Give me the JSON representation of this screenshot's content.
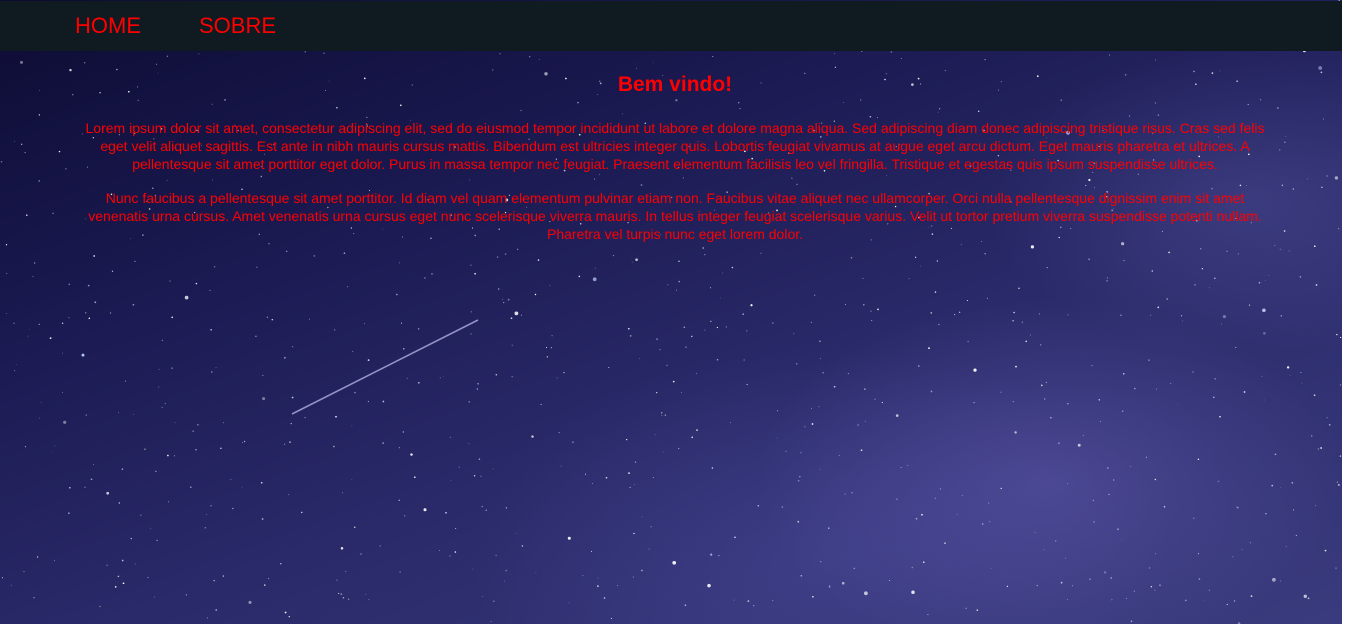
{
  "nav": {
    "home": "HOME",
    "sobre": "SOBRE"
  },
  "main": {
    "title": "Bem vindo!",
    "paragraphs": [
      "Lorem ipsum dolor sit amet, consectetur adipiscing elit, sed do eiusmod tempor incididunt ut labore et dolore magna aliqua. Sed adipiscing diam donec adipiscing tristique risus. Cras sed felis eget velit aliquet sagittis. Est ante in nibh mauris cursus mattis. Bibendum est ultricies integer quis. Lobortis feugiat vivamus at augue eget arcu dictum. Eget mauris pharetra et ultrices. A pellentesque sit amet porttitor eget dolor. Purus in massa tempor nec feugiat. Praesent elementum facilisis leo vel fringilla. Tristique et egestas quis ipsum suspendisse ultrices.",
      "Nunc faucibus a pellentesque sit amet porttitor. Id diam vel quam elementum pulvinar etiam non. Faucibus vitae aliquet nec ullamcorper. Orci nulla pellentesque dignissim enim sit amet venenatis urna cursus. Amet venenatis urna cursus eget nunc scelerisque viverra mauris. In tellus integer feugiat scelerisque varius. Velit ut tortor pretium viverra suspendisse potenti nullam. Pharetra vel turpis nunc eget lorem dolor."
    ]
  },
  "colors": {
    "text_accent": "#ff0000",
    "navbar_background": "#0f1a21",
    "sky_dark": "#0d0c33",
    "sky_light": "#3a3b7e"
  },
  "background": {
    "image": "starry-night-sky"
  }
}
